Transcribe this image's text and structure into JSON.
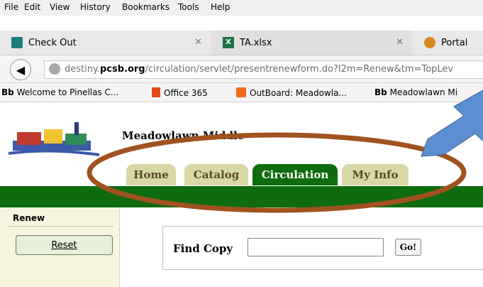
{
  "menu": {
    "items": [
      "File",
      "Edit",
      "View",
      "History",
      "Bookmarks",
      "Tools",
      "Help"
    ],
    "underline": [
      "F",
      "E",
      "V",
      "s",
      "B",
      "T",
      "H"
    ]
  },
  "tabs": [
    {
      "label": "Check Out",
      "icon": "destiny-icon"
    },
    {
      "label": "TA.xlsx",
      "icon": "excel-icon"
    },
    {
      "label": "Portal",
      "icon": "portal-icon"
    }
  ],
  "url": {
    "prefix": "destiny.",
    "domain": "pcsb.org",
    "path": "/circulation/servlet/presentrenewform.do?l2m=Renew&tm=TopLev"
  },
  "bookmarks": [
    {
      "prefix": "Bb",
      "label": "Welcome to Pinellas C..."
    },
    {
      "prefix": "",
      "label": "Office 365"
    },
    {
      "prefix": "",
      "label": "OutBoard: Meadowla..."
    },
    {
      "prefix": "Bb",
      "label": "Meadowlawn Mi"
    }
  ],
  "page": {
    "school_name": "Meadowlawn Middle",
    "nav_tabs": [
      "Home",
      "Catalog",
      "Circulation",
      "My Info"
    ],
    "active_tab": "Circulation",
    "sidebar_title": "Renew",
    "reset_label": "Reset",
    "find_label": "Find Copy",
    "find_value": "",
    "go_label": "Go!"
  },
  "colors": {
    "green_bar": "#0e6b0e",
    "tab_inactive": "#d8d7a6",
    "tab_active": "#0e6b0e",
    "annotation_oval": "#a0521f",
    "annotation_arrow": "#5b8fd1"
  }
}
